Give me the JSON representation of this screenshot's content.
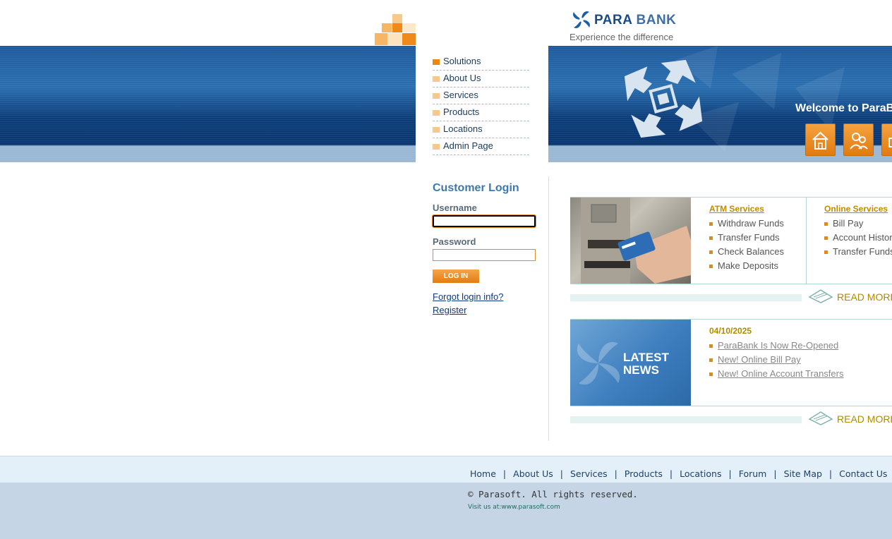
{
  "brand": {
    "name_part1": "PARA",
    "name_part2": "BANK",
    "tagline": "Experience the difference"
  },
  "menu": [
    {
      "label": "Solutions"
    },
    {
      "label": "About Us"
    },
    {
      "label": "Services"
    },
    {
      "label": "Products"
    },
    {
      "label": "Locations"
    },
    {
      "label": "Admin Page"
    }
  ],
  "header": {
    "welcome": "Welcome to ParaB"
  },
  "login": {
    "title": "Customer Login",
    "username_label": "Username",
    "password_label": "Password",
    "username_value": "",
    "password_value": "",
    "button_label": "LOG IN",
    "forgot_link": "Forgot login info?",
    "register_link": "Register"
  },
  "services": {
    "atm_heading": "ATM Services",
    "atm_items": [
      "Withdraw Funds",
      "Transfer Funds",
      "Check Balances",
      "Make Deposits"
    ],
    "online_heading": "Online Services",
    "online_items": [
      "Bill Pay",
      "Account History",
      "Transfer Funds"
    ],
    "read_more": "READ MORE"
  },
  "news": {
    "image_title_line1": "LATEST",
    "image_title_line2": "NEWS",
    "date": "04/10/2025",
    "items": [
      "ParaBank Is Now Re-Opened",
      "New! Online Bill Pay",
      "New! Online Account Transfers"
    ],
    "read_more": "READ MORE"
  },
  "footer": {
    "links": [
      "Home",
      "About Us",
      "Services",
      "Products",
      "Locations",
      "Forum",
      "Site Map",
      "Contact Us"
    ],
    "separator": "|",
    "copyright": "© Parasoft. All rights reserved.",
    "visit_prefix": "Visit us at:",
    "visit_url": "www.parasoft.com"
  },
  "colors": {
    "accent_orange": "#e88a10",
    "brand_blue": "#1a4b86",
    "header_blue": "#0d3e7a"
  }
}
